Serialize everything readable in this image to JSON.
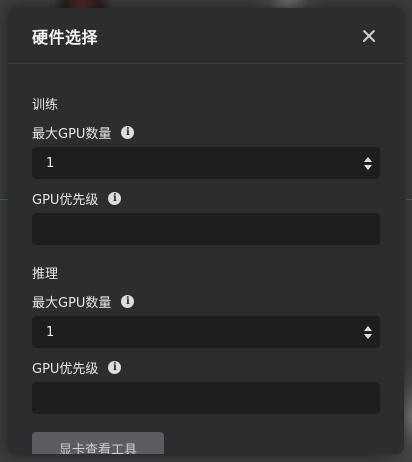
{
  "modal": {
    "title": "硬件选择"
  },
  "training": {
    "section_label": "训练",
    "max_gpu_label": "最大GPU数量",
    "max_gpu_value": "1",
    "gpu_priority_label": "GPU优先级",
    "gpu_priority_value": ""
  },
  "inference": {
    "section_label": "推理",
    "max_gpu_label": "最大GPU数量",
    "max_gpu_value": "1",
    "gpu_priority_label": "GPU优先级",
    "gpu_priority_value": ""
  },
  "footer": {
    "gpu_tool_button": "显卡查看工具"
  },
  "icons": {
    "info": "info-icon",
    "close": "close-icon"
  },
  "colors": {
    "modal_bg": "#2d2d30",
    "input_bg": "#1e1e21",
    "button_bg": "#5c5c63"
  }
}
